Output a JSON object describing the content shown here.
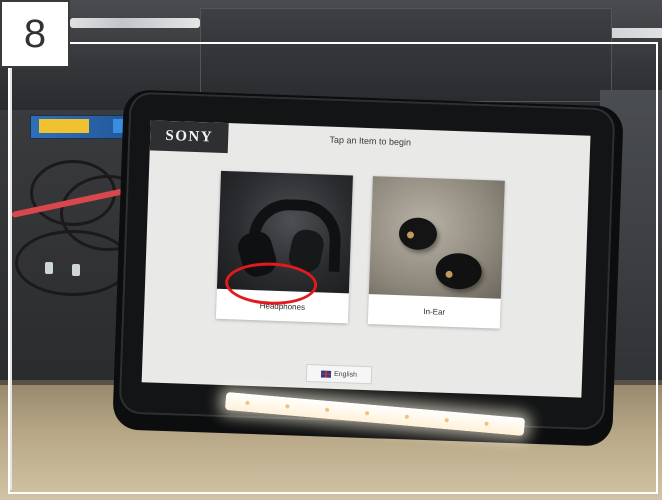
{
  "step": {
    "number": "8"
  },
  "kiosk": {
    "brand": "SONY",
    "header": "Tap an Item to begin",
    "items": [
      {
        "label": "Headphones",
        "image": "over-ear-headphones-photo"
      },
      {
        "label": "In-Ear",
        "image": "earbuds-photo"
      }
    ],
    "language_button": {
      "label": "English",
      "icon": "uk-flag-icon"
    }
  },
  "annotation": {
    "target": "Headphones",
    "color": "#e31a1c"
  },
  "colors": {
    "screen_bg": "#e9e9e7",
    "logo_bg": "#2e2f31",
    "annotation_red": "#e31a1c"
  }
}
